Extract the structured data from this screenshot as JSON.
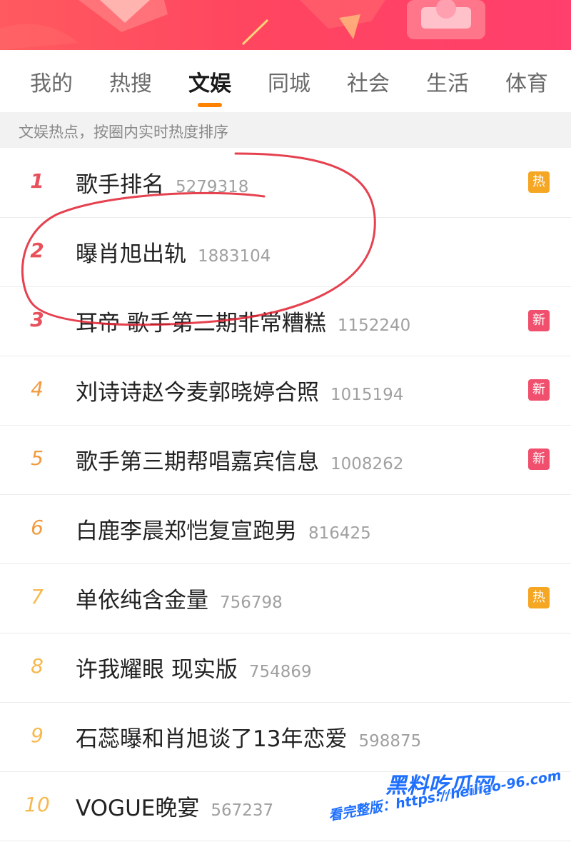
{
  "tabs": [
    {
      "label": "我的"
    },
    {
      "label": "热搜"
    },
    {
      "label": "文娱",
      "active": true
    },
    {
      "label": "同城"
    },
    {
      "label": "社会"
    },
    {
      "label": "生活"
    },
    {
      "label": "体育"
    }
  ],
  "subtitle": "文娱热点，按圈内实时热度排序",
  "colors": {
    "accent": "#ff8200",
    "hot_badge": "#f5a623",
    "new_badge": "#f0506e",
    "rank_top": "#e8505b",
    "rank_mid": "#f19a3e",
    "rank_low": "#f6b94e"
  },
  "items": [
    {
      "rank": "1",
      "title": "歌手排名",
      "count": "5279318",
      "badge": "热",
      "badge_type": "hot"
    },
    {
      "rank": "2",
      "title": "曝肖旭出轨",
      "count": "1883104",
      "badge": "",
      "badge_type": ""
    },
    {
      "rank": "3",
      "title": "耳帝 歌手第二期非常糟糕",
      "count": "1152240",
      "badge": "新",
      "badge_type": "new"
    },
    {
      "rank": "4",
      "title": "刘诗诗赵今麦郭晓婷合照",
      "count": "1015194",
      "badge": "新",
      "badge_type": "new"
    },
    {
      "rank": "5",
      "title": "歌手第三期帮唱嘉宾信息",
      "count": "1008262",
      "badge": "新",
      "badge_type": "new"
    },
    {
      "rank": "6",
      "title": "白鹿李晨郑恺复宣跑男",
      "count": "816425",
      "badge": "",
      "badge_type": ""
    },
    {
      "rank": "7",
      "title": "单依纯含金量",
      "count": "756798",
      "badge": "热",
      "badge_type": "hot"
    },
    {
      "rank": "8",
      "title": "许我耀眼 现实版",
      "count": "754869",
      "badge": "",
      "badge_type": ""
    },
    {
      "rank": "9",
      "title": "石蕊曝和肖旭谈了13年恋爱",
      "count": "598875",
      "badge": "",
      "badge_type": ""
    },
    {
      "rank": "10",
      "title": "VOGUE晚宴",
      "count": "567237",
      "badge": "",
      "badge_type": ""
    }
  ],
  "watermark": {
    "line1": "黑料吃瓜网",
    "line2": "看完整版：https://heiliao-96.com"
  }
}
